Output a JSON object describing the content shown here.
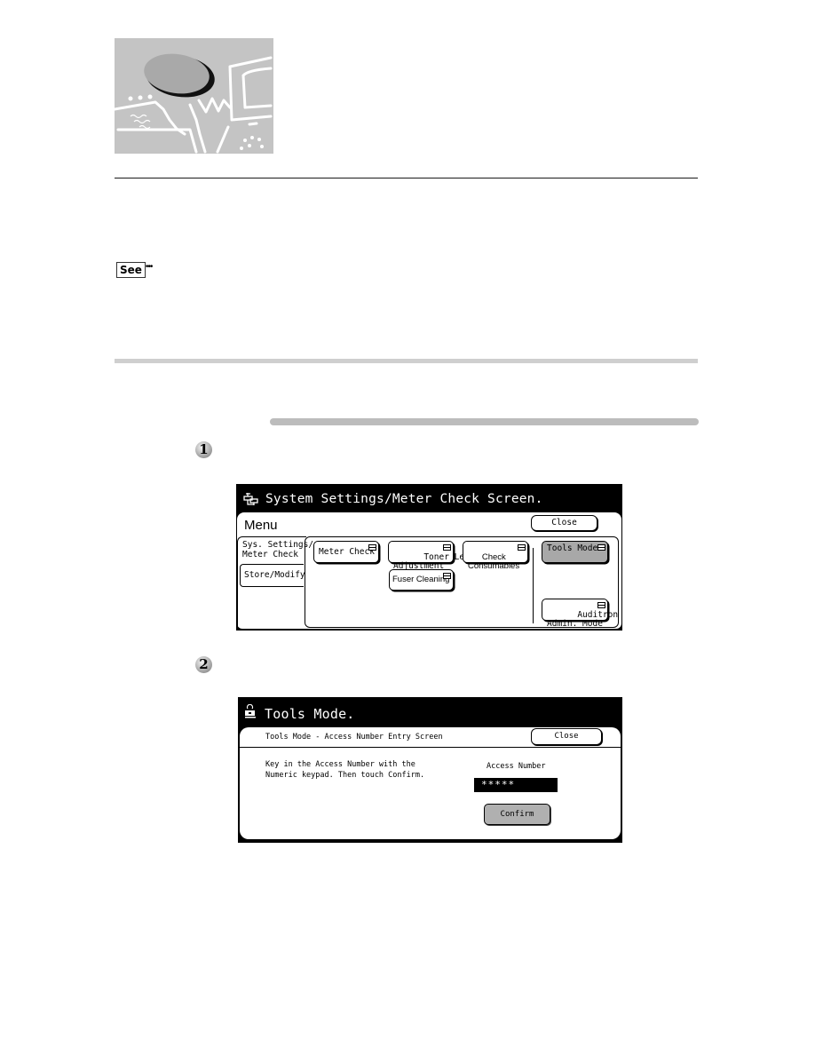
{
  "page": {
    "see_icon_label": "See",
    "step_markers": [
      "1",
      "2"
    ]
  },
  "screen1": {
    "title": "System Settings/Meter Check Screen.",
    "icon": "system-settings-icon",
    "menu_label": "Menu",
    "close_label": "Close",
    "tabs": [
      {
        "label": "Sys. Settings/\nMeter Check",
        "selected": true
      },
      {
        "label": "Store/Modify",
        "selected": false
      }
    ],
    "buttons": [
      {
        "label": "Meter Check",
        "highlighted": false
      },
      {
        "label": "Toner Level\nAdjustment",
        "highlighted": false
      },
      {
        "label": "Check\nConsumables",
        "highlighted": false
      },
      {
        "label": "Fuser Cleaning",
        "highlighted": false
      },
      {
        "label": "Tools Mode",
        "highlighted": true
      },
      {
        "label": "Auditron\nAdmin. Mode",
        "highlighted": false
      }
    ]
  },
  "screen2": {
    "title": "Tools Mode.",
    "icon": "tools-mode-icon",
    "subtitle": "Tools Mode - Access Number Entry Screen",
    "close_label": "Close",
    "message": "Key in the Access Number with the\nNumeric keypad. Then touch Confirm.",
    "access_label": "Access Number",
    "access_value": "*****",
    "confirm_label": "Confirm"
  },
  "colors": {
    "screen_bg": "#000000",
    "highlight_button": "#a8a8a8",
    "divider_gray": "#cfcfcf"
  }
}
